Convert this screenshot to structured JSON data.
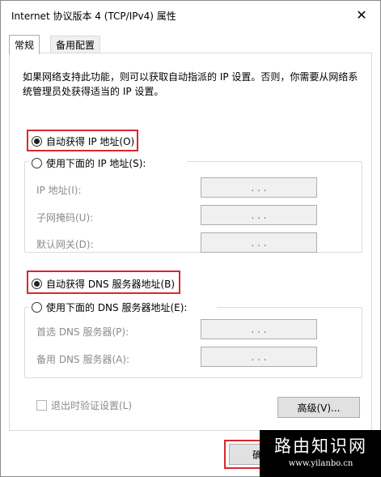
{
  "window": {
    "title": "Internet 协议版本 4 (TCP/IPv4) 属性",
    "close_glyph": "✕"
  },
  "tabs": [
    {
      "label": "常规",
      "active": true
    },
    {
      "label": "备用配置",
      "active": false
    }
  ],
  "description": "如果网络支持此功能，则可以获取自动指派的 IP 设置。否则，你需要从网络系统管理员处获得适当的 IP 设置。",
  "ip_section": {
    "auto_label": "自动获得 IP 地址(O)",
    "auto_selected": true,
    "manual_label": "使用下面的 IP 地址(S):",
    "manual_selected": false,
    "fields": [
      {
        "label": "IP 地址(I):",
        "value": ". . ."
      },
      {
        "label": "子网掩码(U):",
        "value": ". . ."
      },
      {
        "label": "默认网关(D):",
        "value": ". . ."
      }
    ]
  },
  "dns_section": {
    "auto_label": "自动获得 DNS 服务器地址(B)",
    "auto_selected": true,
    "manual_label": "使用下面的 DNS 服务器地址(E):",
    "manual_selected": false,
    "fields": [
      {
        "label": "首选 DNS 服务器(P):",
        "value": ". . ."
      },
      {
        "label": "备用 DNS 服务器(A):",
        "value": ". . ."
      }
    ]
  },
  "validate_label": "退出时验证设置(L)",
  "advanced_label": "高级(V)...",
  "ok_label": "确",
  "highlight_color": "#d9272e",
  "watermark": {
    "title": "路由知识网",
    "url": "www.yilanbo.cn"
  }
}
